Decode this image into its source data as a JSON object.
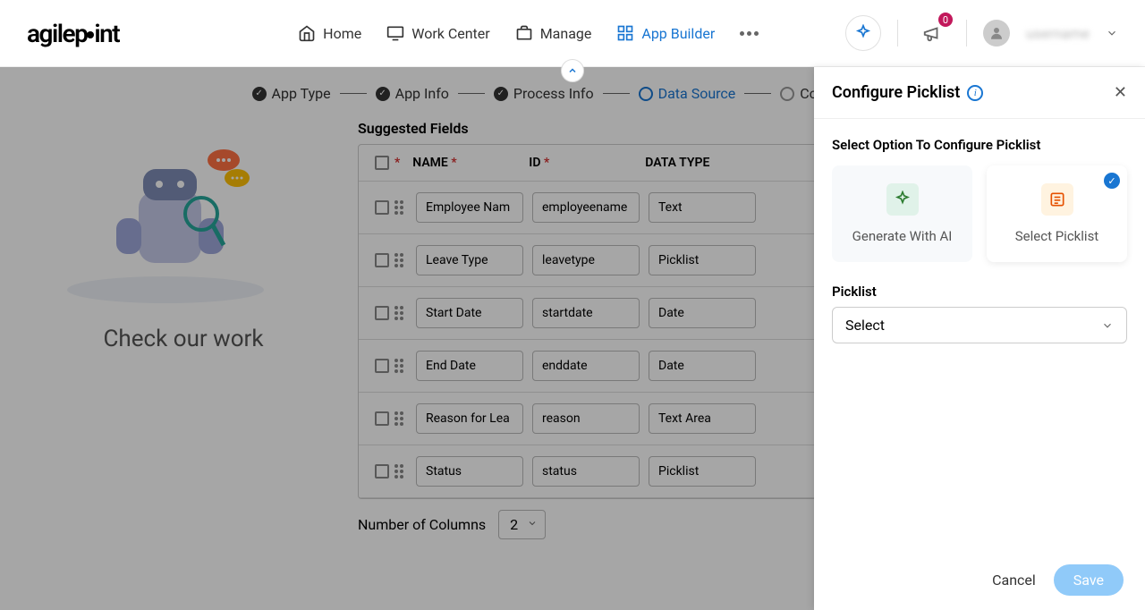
{
  "header": {
    "logo_text": "agilepoint",
    "nav": {
      "home": "Home",
      "work_center": "Work Center",
      "manage": "Manage",
      "app_builder": "App Builder"
    },
    "badge_count": "0",
    "user_name": "username"
  },
  "stepper": {
    "app_type": "App Type",
    "app_info": "App Info",
    "process_info": "Process Info",
    "data_source": "Data Source",
    "configurations": "Configurations"
  },
  "illustration_title": "Check our work",
  "fields": {
    "title": "Suggested Fields",
    "columns": {
      "name": "NAME",
      "id": "ID",
      "type": "DATA TYPE"
    },
    "rows": [
      {
        "name": "Employee Nam",
        "id": "employeename",
        "type": "Text"
      },
      {
        "name": "Leave Type",
        "id": "leavetype",
        "type": "Picklist"
      },
      {
        "name": "Start Date",
        "id": "startdate",
        "type": "Date"
      },
      {
        "name": "End Date",
        "id": "enddate",
        "type": "Date"
      },
      {
        "name": "Reason for Lea",
        "id": "reason",
        "type": "Text Area"
      },
      {
        "name": "Status",
        "id": "status",
        "type": "Picklist"
      }
    ],
    "num_cols_label": "Number of Columns",
    "num_cols_value": "2"
  },
  "panel": {
    "title": "Configure Picklist",
    "section_label": "Select Option To Configure Picklist",
    "opt_ai": "Generate With AI",
    "opt_pick": "Select Picklist",
    "picklist_label": "Picklist",
    "picklist_placeholder": "Select",
    "cancel": "Cancel",
    "save": "Save"
  }
}
